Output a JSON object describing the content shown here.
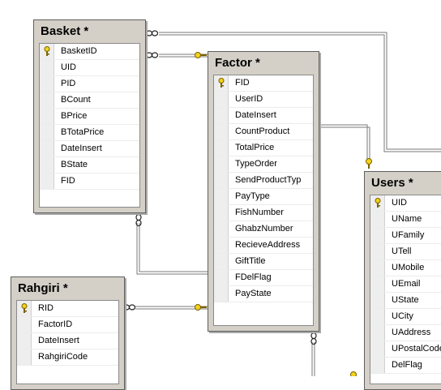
{
  "tables": {
    "basket": {
      "title": "Basket *",
      "columns": [
        {
          "name": "BasketID",
          "pk": true
        },
        {
          "name": "UID"
        },
        {
          "name": "PID"
        },
        {
          "name": "BCount"
        },
        {
          "name": "BPrice"
        },
        {
          "name": "BTotaPrice"
        },
        {
          "name": "DateInsert"
        },
        {
          "name": "BState"
        },
        {
          "name": "FID"
        }
      ]
    },
    "factor": {
      "title": "Factor *",
      "columns": [
        {
          "name": "FID",
          "pk": true
        },
        {
          "name": "UserID"
        },
        {
          "name": "DateInsert"
        },
        {
          "name": "CountProduct"
        },
        {
          "name": "TotalPrice"
        },
        {
          "name": "TypeOrder"
        },
        {
          "name": "SendProductTyp"
        },
        {
          "name": "PayType"
        },
        {
          "name": "FishNumber"
        },
        {
          "name": "GhabzNumber"
        },
        {
          "name": "RecieveAddress"
        },
        {
          "name": "GiftTitle"
        },
        {
          "name": "FDelFlag"
        },
        {
          "name": "PayState"
        }
      ]
    },
    "rahgiri": {
      "title": "Rahgiri *",
      "columns": [
        {
          "name": "RID",
          "pk": true
        },
        {
          "name": "FactorID"
        },
        {
          "name": "DateInsert"
        },
        {
          "name": "RahgiriCode"
        }
      ]
    },
    "users": {
      "title": "Users *",
      "columns": [
        {
          "name": "UID",
          "pk": true
        },
        {
          "name": "UName"
        },
        {
          "name": "UFamily"
        },
        {
          "name": "UTell"
        },
        {
          "name": "UMobile"
        },
        {
          "name": "UEmail"
        },
        {
          "name": "UState"
        },
        {
          "name": "UCity"
        },
        {
          "name": "UAddress"
        },
        {
          "name": "UPostalCode"
        },
        {
          "name": "DelFlag"
        }
      ]
    }
  },
  "relationships": [
    {
      "from": "basket",
      "to": "factor"
    },
    {
      "from": "basket",
      "to": "users"
    },
    {
      "from": "basket",
      "to": "factor"
    },
    {
      "from": "factor",
      "to": "users"
    },
    {
      "from": "rahgiri",
      "to": "factor"
    },
    {
      "from": "factor",
      "to": "users"
    }
  ],
  "colors": {
    "line": "#7a7a7a",
    "key": "#e8c020",
    "header": "#d4d0c8"
  }
}
